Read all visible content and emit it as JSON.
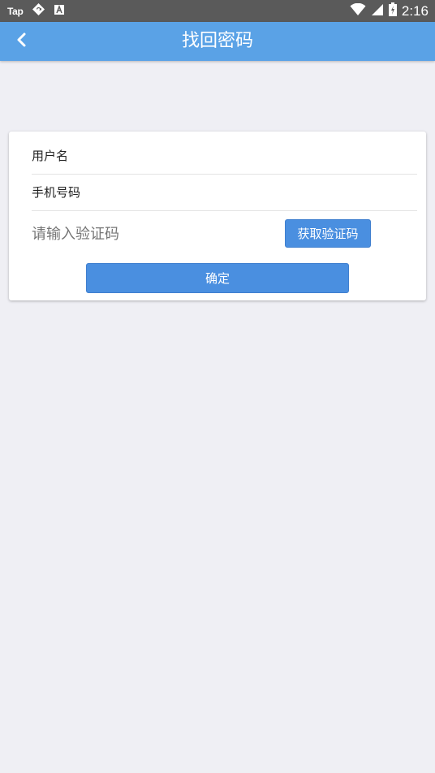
{
  "status_bar": {
    "app_label": "Tap",
    "time": "2:16"
  },
  "header": {
    "title": "找回密码"
  },
  "form": {
    "username_placeholder": "用户名",
    "phone_placeholder": "手机号码",
    "code_placeholder": "请输入验证码",
    "get_code_label": "获取验证码",
    "confirm_label": "确定"
  },
  "colors": {
    "header_bg": "#5aa2e6",
    "button_bg": "#4a8fe0",
    "page_bg": "#efeff4",
    "status_bar_bg": "#5a5a5a"
  },
  "icons": {
    "back": "chevron-left-icon",
    "status": [
      "tap-app-icon",
      "sync-icon",
      "font-a-icon",
      "wifi-icon",
      "signal-icon",
      "battery-icon"
    ]
  }
}
